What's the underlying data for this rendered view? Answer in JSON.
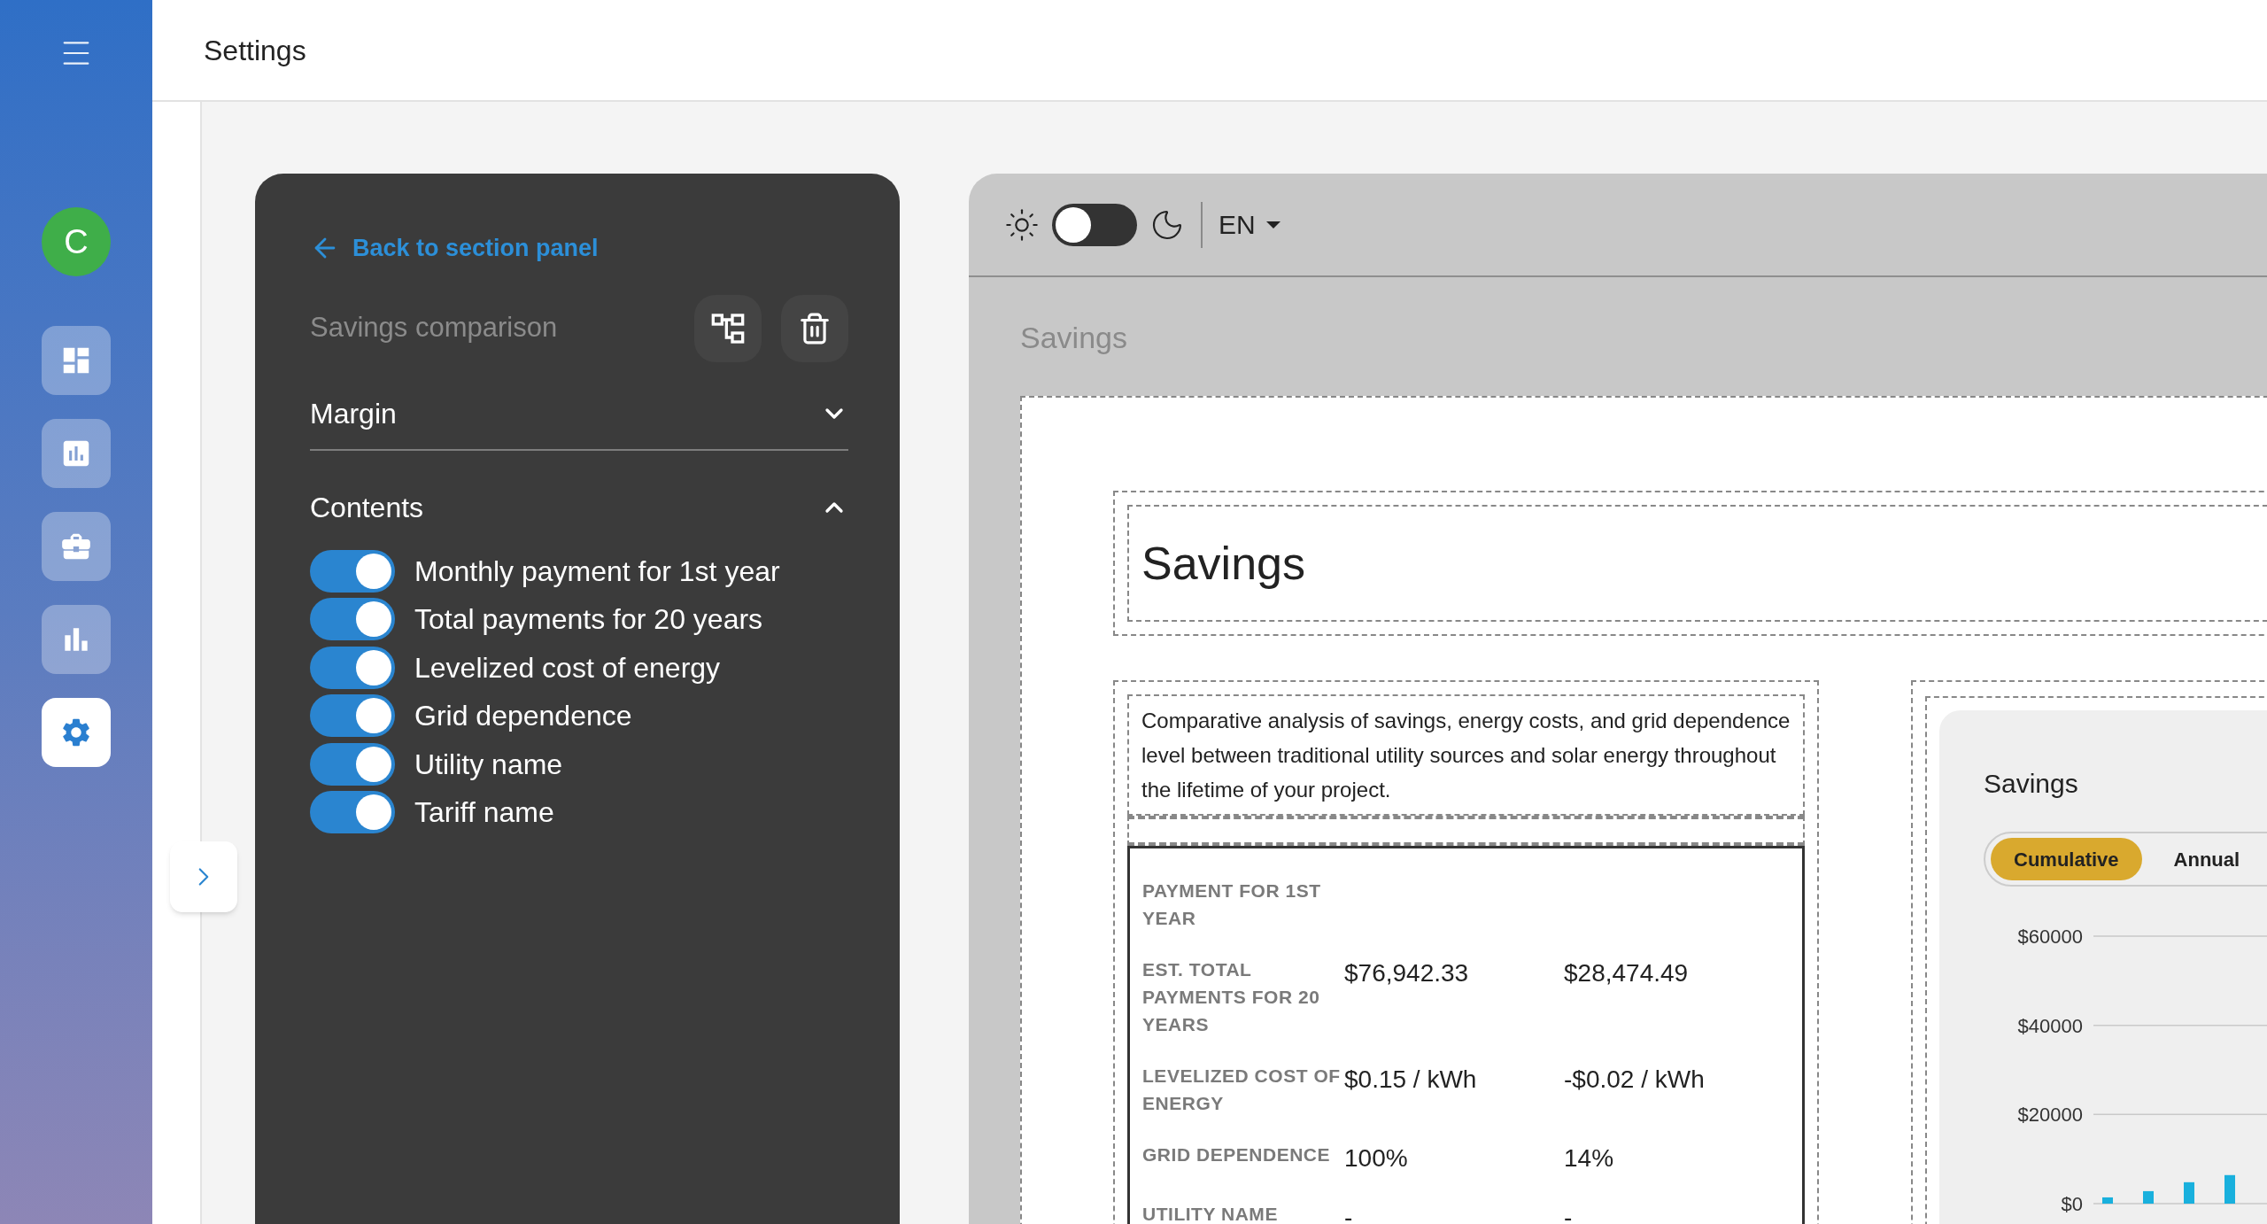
{
  "sidebar": {
    "avatar": "C",
    "items": [
      {
        "selected": false
      },
      {
        "selected": false
      },
      {
        "selected": false
      },
      {
        "selected": false
      },
      {
        "selected": true
      }
    ]
  },
  "header": {
    "title": "Settings"
  },
  "editor": {
    "back_link": "Back to section panel",
    "section_name": "Savings comparison",
    "groups": [
      {
        "label": "Margin",
        "expanded": false
      },
      {
        "label": "Contents",
        "expanded": true
      }
    ],
    "toggles": [
      {
        "label": "Monthly payment for 1st year",
        "on": true
      },
      {
        "label": "Total payments for 20 years",
        "on": true
      },
      {
        "label": "Levelized cost of energy",
        "on": true
      },
      {
        "label": "Grid dependence",
        "on": true
      },
      {
        "label": "Utility name",
        "on": true
      },
      {
        "label": "Tariff name",
        "on": true
      }
    ]
  },
  "preview": {
    "dark_theme": false,
    "language": "EN",
    "section_label": "Savings",
    "page_title": "Savings",
    "description": "Comparative analysis of savings, energy costs, and grid dependence level between traditional utility sources and solar energy throughout the lifetime of your project.",
    "table": {
      "rows": [
        {
          "label": "PAYMENT FOR 1ST YEAR",
          "values": []
        },
        {
          "label": "EST. TOTAL PAYMENTS FOR 20 YEARS",
          "values": [
            "$76,942.33",
            "$28,474.49"
          ]
        },
        {
          "label": "LEVELIZED COST OF ENERGY",
          "values": [
            "$0.15 / kWh",
            "-$0.02 / kWh"
          ]
        },
        {
          "label": "GRID DEPENDENCE",
          "values": [
            "100%",
            "14%"
          ]
        },
        {
          "label": "UTILITY NAME",
          "values": [
            "-",
            "-"
          ]
        }
      ]
    },
    "chart": {
      "title": "Savings",
      "tabs": [
        {
          "label": "Cumulative",
          "selected": true
        },
        {
          "label": "Annual",
          "selected": false
        }
      ],
      "chart_data": {
        "type": "bar",
        "ylim": [
          0,
          60000
        ],
        "yticks": [
          {
            "value": 0,
            "label": "$0"
          },
          {
            "value": 20000,
            "label": "$20000"
          },
          {
            "value": 40000,
            "label": "$40000"
          },
          {
            "value": 60000,
            "label": "$60000"
          }
        ],
        "series": [
          {
            "color": "#19b0dd",
            "values": [
              1400,
              2800,
              4800,
              6400
            ]
          }
        ]
      }
    }
  }
}
